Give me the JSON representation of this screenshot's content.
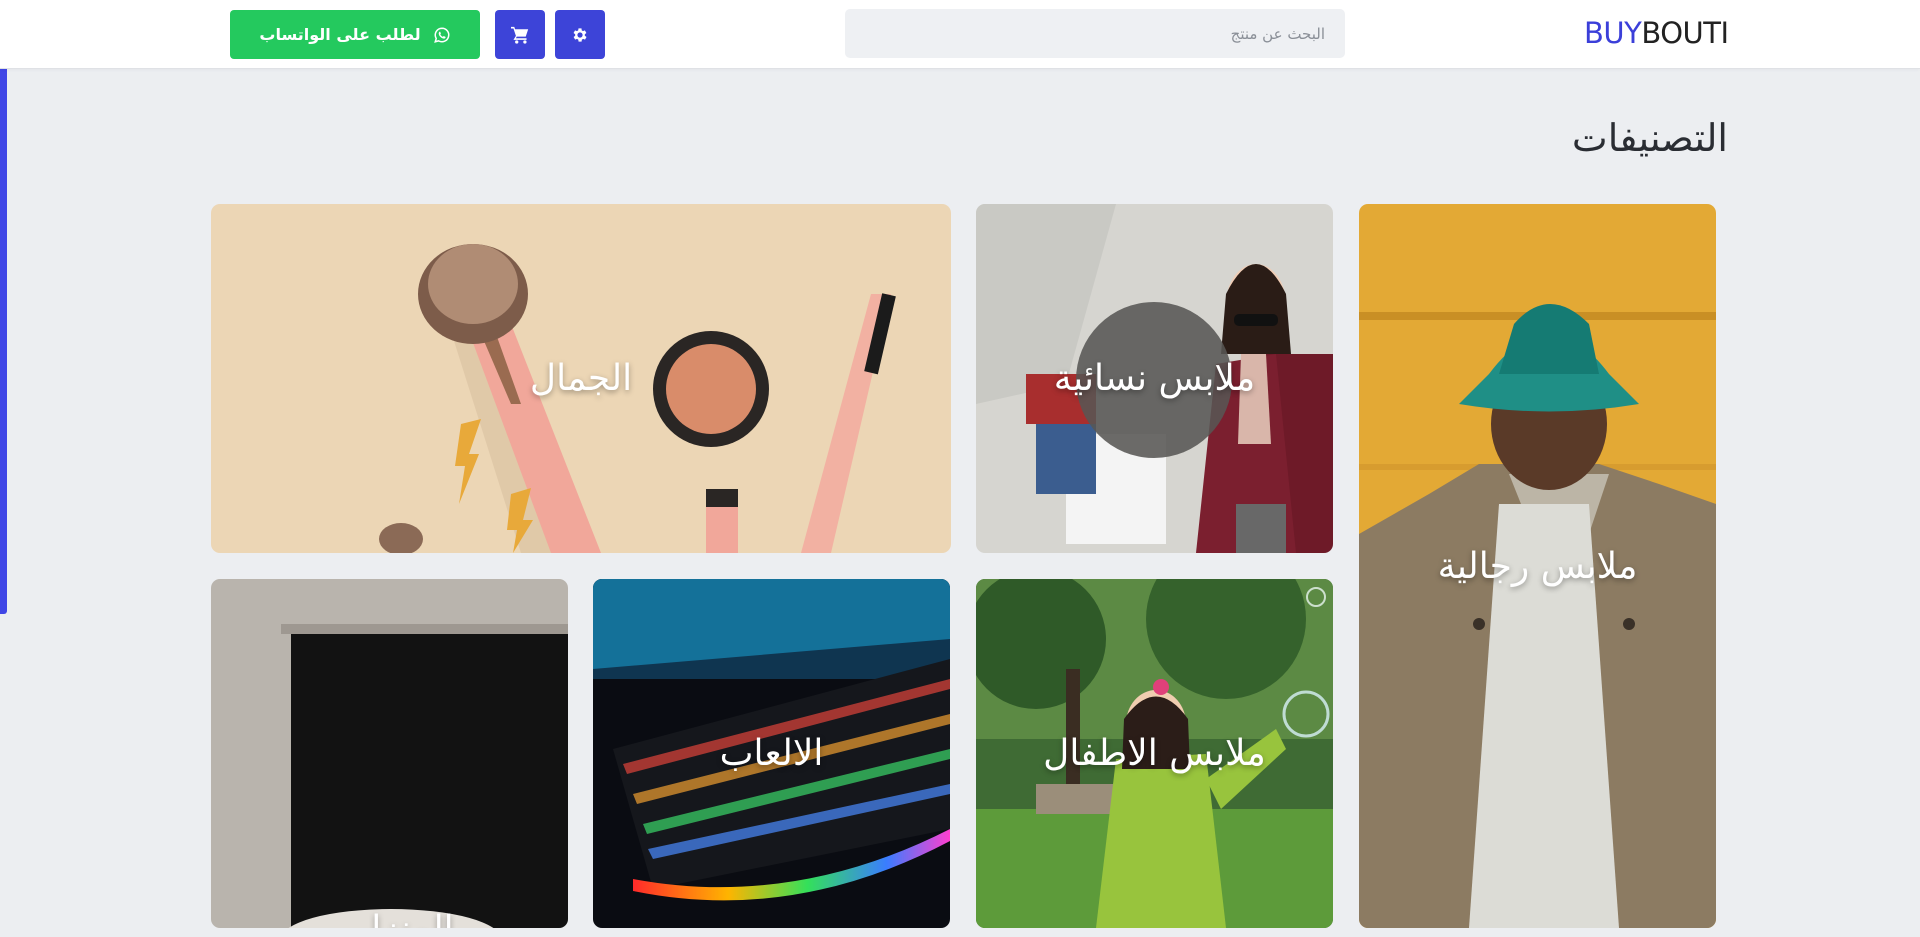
{
  "header": {
    "logo_part1": "BUY",
    "logo_part2": "BOUTI",
    "search_placeholder": "البحث عن منتج",
    "whatsapp_label": "لطلب على الواتساب",
    "settings_icon": "gear-icon",
    "cart_icon": "cart-icon",
    "whatsapp_icon": "whatsapp-icon"
  },
  "page": {
    "heading": "التصنيفات"
  },
  "categories": [
    {
      "title": "ملابس رجالية"
    },
    {
      "title": "ملابس نسائية"
    },
    {
      "title": "الجمال"
    },
    {
      "title": "ملابس الاطفال"
    },
    {
      "title": "الالعاب"
    },
    {
      "title": "المنزل"
    }
  ],
  "colors": {
    "accent": "#3d44d8",
    "whatsapp": "#24c95e",
    "background": "#eceef1"
  }
}
